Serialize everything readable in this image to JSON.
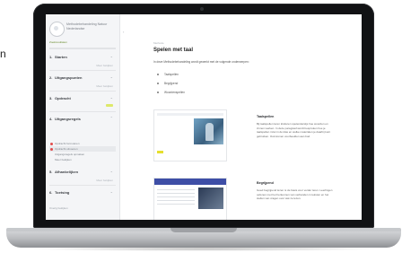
{
  "page": {
    "stray_text": "n"
  },
  "sidebar": {
    "brand": "Methodebehandeling Natuur Nederlandse",
    "search_label": "Zoekresultaten",
    "sections": [
      {
        "num": "1.",
        "title": "Starten",
        "meta": "Meer bekijken"
      },
      {
        "num": "2.",
        "title": "Uitgangspunten",
        "meta": "Meer bekijken"
      },
      {
        "num": "3.",
        "title": "Opdracht",
        "meta": ""
      },
      {
        "num": "4.",
        "title": "Uitgangsregels",
        "meta": ""
      },
      {
        "num": "5.",
        "title": "Afhankelijken",
        "meta": "Meer bekijken"
      },
      {
        "num": "6.",
        "title": "Toetsing",
        "meta": ""
      }
    ],
    "sub_items": [
      {
        "label": "Opdracht formuleren",
        "active": false
      },
      {
        "label": "Opdracht uitvoeren",
        "active": true
      },
      {
        "label": "Uitgangsregels opmaken",
        "active": false
      },
      {
        "label": "Meer bekijken",
        "active": false
      }
    ],
    "bottom_label": "Overig bekijken"
  },
  "content": {
    "breadcrumb": "Methode",
    "title": "Spelen met taal",
    "intro": "In deze Methodebehandeling wordt gewerkt met de volgende onderwerpen:",
    "bullets": [
      "Taalspellen",
      "Begrijpend",
      "Woordenspellen"
    ],
    "sections": [
      {
        "title": "Taalspellen",
        "text": "Bij taalspellen leren kinderen spelenderwijs hoe woorden en zinnen werken. In deze paragraaf wordt besproken hoe je taalspellen inzet in de klas en welke materialen je daarbij kunt gebruiken. Ook komen voorbeelden aan bod."
      },
      {
        "title": "Begrijpend",
        "text": "Goed begrijpend lezen is de basis voor verder leren. Leerlingen oefenen met het herkennen van verbanden in teksten en het stellen van vragen over wat ze lezen."
      }
    ]
  },
  "colors": {
    "accent_yellow": "#e6df2f",
    "accent_green": "#6a8c2f",
    "alert_red": "#e14c4c",
    "header_blue": "#3e4ea6"
  }
}
